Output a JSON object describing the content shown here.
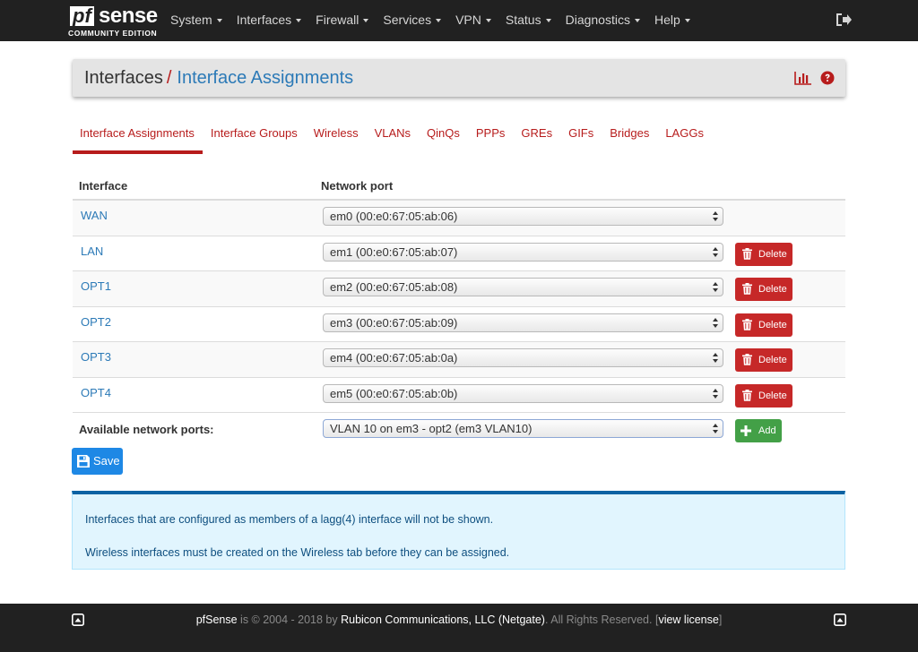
{
  "brand": {
    "logo_mark": "pf",
    "logo_word": "sense",
    "edition": "COMMUNITY EDITION"
  },
  "nav": {
    "items": [
      {
        "label": "System"
      },
      {
        "label": "Interfaces"
      },
      {
        "label": "Firewall"
      },
      {
        "label": "Services"
      },
      {
        "label": "VPN"
      },
      {
        "label": "Status"
      },
      {
        "label": "Diagnostics"
      },
      {
        "label": "Help"
      }
    ],
    "logout_icon": "sign-out-icon"
  },
  "breadcrumb": {
    "parent": "Interfaces",
    "separator": "/",
    "current": "Interface Assignments",
    "icons": [
      "bar-chart-icon",
      "question-circle-icon"
    ]
  },
  "tabs": [
    {
      "label": "Interface Assignments",
      "active": true
    },
    {
      "label": "Interface Groups"
    },
    {
      "label": "Wireless"
    },
    {
      "label": "VLANs"
    },
    {
      "label": "QinQs"
    },
    {
      "label": "PPPs"
    },
    {
      "label": "GREs"
    },
    {
      "label": "GIFs"
    },
    {
      "label": "Bridges"
    },
    {
      "label": "LAGGs"
    }
  ],
  "table": {
    "headers": {
      "interface": "Interface",
      "network_port": "Network port"
    },
    "rows": [
      {
        "interface": "WAN",
        "port": "em0 (00:e0:67:05:ab:06)"
      },
      {
        "interface": "LAN",
        "port": "em1 (00:e0:67:05:ab:07)",
        "action": "Delete"
      },
      {
        "interface": "OPT1",
        "port": "em2 (00:e0:67:05:ab:08)",
        "action": "Delete"
      },
      {
        "interface": "OPT2",
        "port": "em3 (00:e0:67:05:ab:09)",
        "action": "Delete"
      },
      {
        "interface": "OPT3",
        "port": "em4 (00:e0:67:05:ab:0a)",
        "action": "Delete"
      },
      {
        "interface": "OPT4",
        "port": "em5 (00:e0:67:05:ab:0b)",
        "action": "Delete"
      }
    ],
    "available": {
      "label": "Available network ports:",
      "selected": "VLAN 10 on em3 - opt2 (em3 VLAN10)",
      "add_label": "Add"
    }
  },
  "save_label": "Save",
  "info": {
    "line1": "Interfaces that are configured as members of a lagg(4) interface will not be shown.",
    "line2": "Wireless interfaces must be created on the Wireless tab before they can be assigned."
  },
  "footer": {
    "product": "pfSense",
    "is": " is © 2004 - 2018 by ",
    "company": "Rubicon Communications, LLC (Netgate)",
    "rights": ". All Rights Reserved. [",
    "license": "view license",
    "close": "]"
  },
  "colors": {
    "navbar": "#212121",
    "accent_red": "#b71c1c",
    "link_blue": "#2c7ab7",
    "save_blue": "#1e88e5",
    "add_green": "#43a047",
    "delete_red": "#c62828",
    "info_bg": "#e1f5fe"
  }
}
